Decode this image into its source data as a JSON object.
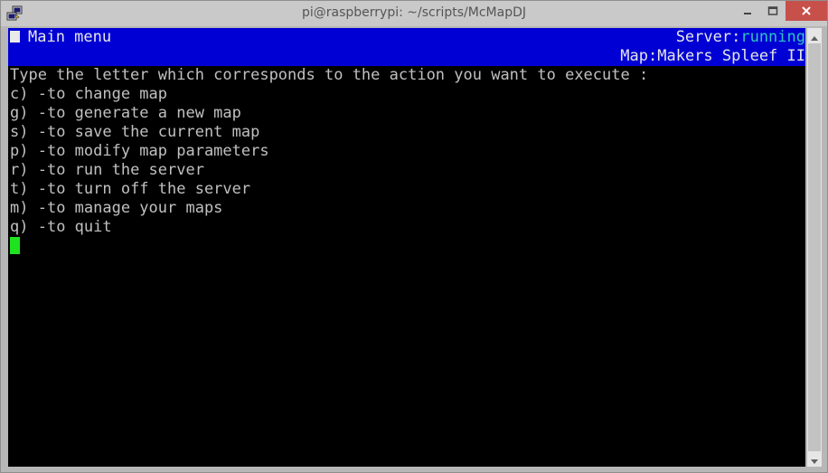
{
  "window": {
    "title": "pi@raspberrypi: ~/scripts/McMapDJ"
  },
  "colors": {
    "header_bg": "#0000d4",
    "running": "#2fc4c4",
    "cursor": "#1fe31f",
    "close_button": "#c7504b"
  },
  "header": {
    "menu_title": "Main menu",
    "server_label": "Server:",
    "server_status": "running",
    "map_label": "Map:",
    "map_name": "Makers Spleef II"
  },
  "prompt": "Type the letter which corresponds to the action you want to execute :",
  "menu_items": [
    {
      "key": "c)",
      "text": " -to change map"
    },
    {
      "key": "g)",
      "text": " -to generate a new map"
    },
    {
      "key": "s)",
      "text": " -to save the current map"
    },
    {
      "key": "p)",
      "text": " -to modify map parameters"
    },
    {
      "key": "r)",
      "text": " -to run the server"
    },
    {
      "key": "t)",
      "text": " -to turn off the server"
    },
    {
      "key": "m)",
      "text": " -to manage your maps"
    },
    {
      "key": "q)",
      "text": " -to quit"
    }
  ],
  "icons": {
    "app": "putty-icon",
    "minimize": "minimize-icon",
    "maximize": "maximize-icon",
    "close": "close-icon"
  }
}
